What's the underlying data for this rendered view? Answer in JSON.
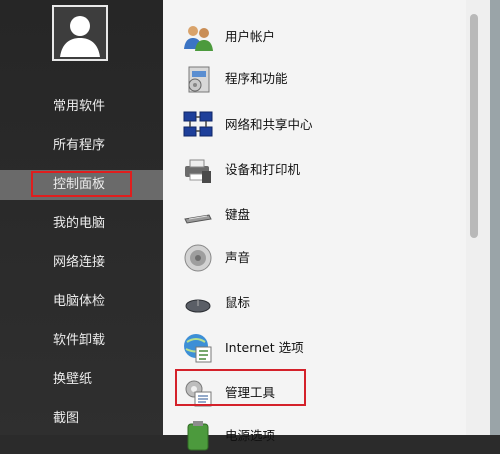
{
  "sidebar": {
    "items": [
      {
        "label": "常用软件"
      },
      {
        "label": "所有程序"
      },
      {
        "label": "控制面板"
      },
      {
        "label": "我的电脑"
      },
      {
        "label": "网络连接"
      },
      {
        "label": "电脑体检"
      },
      {
        "label": "软件卸载"
      },
      {
        "label": "换壁纸"
      },
      {
        "label": "截图"
      }
    ],
    "selected": "控制面板"
  },
  "control_panel": {
    "items": [
      {
        "label": "用户帐户",
        "icon": "users-icon"
      },
      {
        "label": "程序和功能",
        "icon": "programs-icon"
      },
      {
        "label": "网络和共享中心",
        "icon": "network-icon"
      },
      {
        "label": "设备和打印机",
        "icon": "printer-icon"
      },
      {
        "label": "键盘",
        "icon": "keyboard-icon"
      },
      {
        "label": "声音",
        "icon": "speaker-icon"
      },
      {
        "label": "鼠标",
        "icon": "mouse-icon"
      },
      {
        "label": "Internet 选项",
        "icon": "internet-options-icon"
      },
      {
        "label": "管理工具",
        "icon": "admin-tools-icon"
      },
      {
        "label": "电源选项",
        "icon": "power-icon"
      }
    ]
  },
  "colors": {
    "highlight_border": "#e01e1e",
    "sidebar_bg": "#2b2b2b",
    "sidebar_selected_bg": "#6a6a6a",
    "panel_bg": "#f4f4f4"
  }
}
